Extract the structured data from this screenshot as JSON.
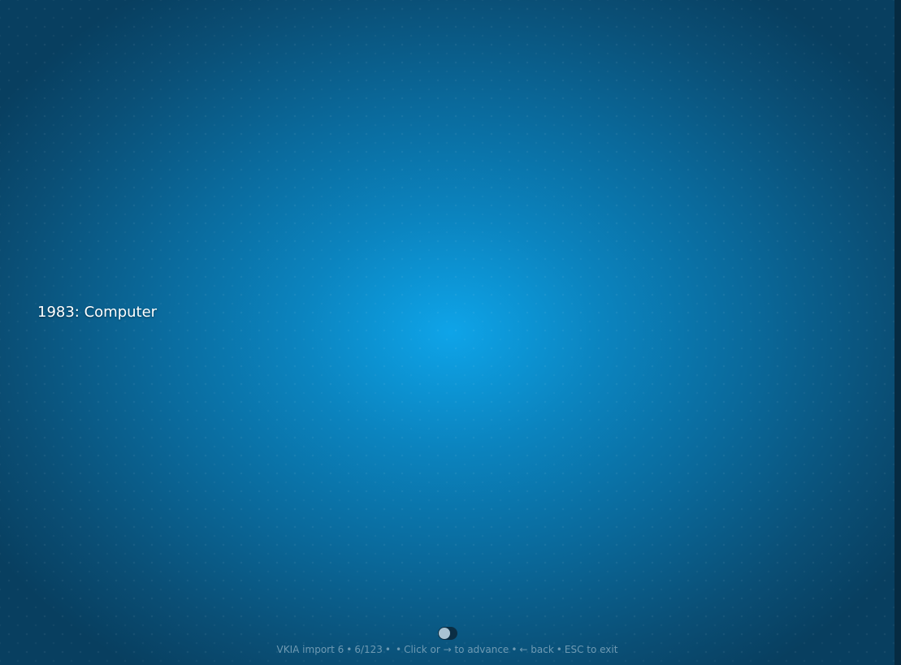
{
  "slide": {
    "title": "1983: Computer"
  },
  "footer": {
    "presentation_name": "VKIA import 6",
    "separator": "•",
    "position": "6/123",
    "empty_segment": "",
    "advance_hint": "Click or → to advance",
    "back_hint": "← back",
    "exit_hint": "ESC to exit"
  },
  "colors": {
    "background_center": "#0ea4e8",
    "background_edge": "#083f60",
    "text": "#ffffff",
    "footer_text": "#6f9ab3"
  },
  "icons": {
    "toggle": "toggle-switch-icon"
  }
}
